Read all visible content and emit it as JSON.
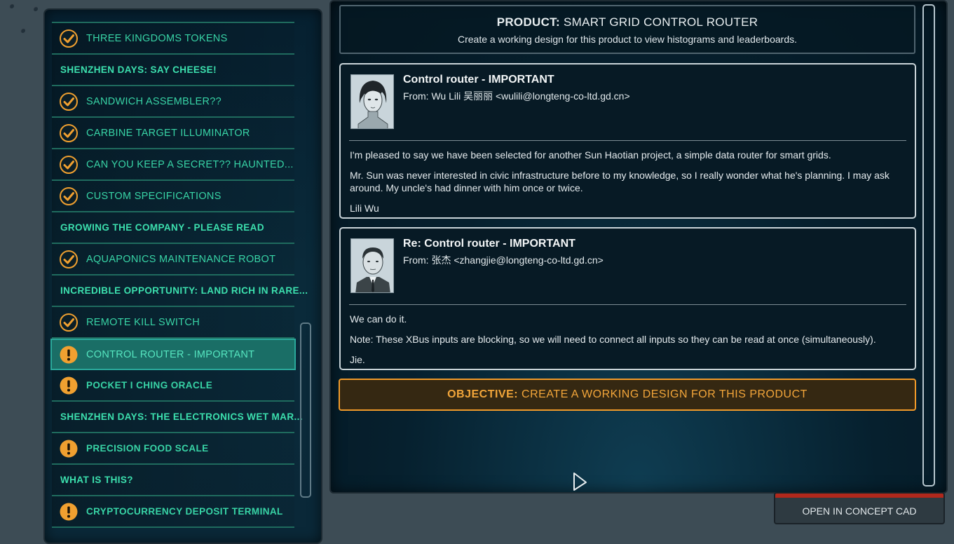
{
  "left_list": {
    "items": [
      {
        "label": "THREE KINGDOMS TOKENS",
        "type": "done"
      },
      {
        "label": "SHENZHEN DAYS: SAY CHEESE!",
        "type": "heading"
      },
      {
        "label": "SANDWICH ASSEMBLER??",
        "type": "done"
      },
      {
        "label": "CARBINE TARGET ILLUMINATOR",
        "type": "done"
      },
      {
        "label": "CAN YOU KEEP A SECRET?? HAUNTED...",
        "type": "done"
      },
      {
        "label": "CUSTOM SPECIFICATIONS",
        "type": "done"
      },
      {
        "label": "GROWING THE COMPANY - PLEASE READ",
        "type": "heading"
      },
      {
        "label": "AQUAPONICS MAINTENANCE ROBOT",
        "type": "done"
      },
      {
        "label": "INCREDIBLE OPPORTUNITY: LAND RICH IN RARE...",
        "type": "heading"
      },
      {
        "label": "REMOTE KILL SWITCH",
        "type": "done"
      },
      {
        "label": "CONTROL ROUTER - IMPORTANT",
        "type": "selected"
      },
      {
        "label": "POCKET I CHING ORACLE",
        "type": "urgent"
      },
      {
        "label": "SHENZHEN DAYS: THE ELECTRONICS WET MAR...",
        "type": "heading"
      },
      {
        "label": "PRECISION FOOD SCALE",
        "type": "urgent"
      },
      {
        "label": "WHAT IS THIS?",
        "type": "heading"
      },
      {
        "label": "CRYPTOCURRENCY DEPOSIT TERMINAL",
        "type": "urgent"
      }
    ]
  },
  "product": {
    "prefix": "PRODUCT:",
    "name": "SMART GRID CONTROL ROUTER",
    "subtitle": "Create a working design for this product to view histograms and leaderboards."
  },
  "emails": [
    {
      "subject": "Control router - IMPORTANT",
      "from": "From: Wu Lili 吴丽丽 <wulili@longteng-co-ltd.gd.cn>",
      "paragraphs": [
        "I'm pleased to say we have been selected for another Sun Haotian project, a simple data router for smart grids.",
        "Mr. Sun was never interested in civic infrastructure before to my knowledge, so I really wonder what he's planning. I may ask around. My uncle's had dinner with him once or twice.",
        "Lili Wu"
      ]
    },
    {
      "subject": "Re: Control router - IMPORTANT",
      "from": "From: 张杰 <zhangjie@longteng-co-ltd.gd.cn>",
      "paragraphs": [
        "We can do it.",
        "Note: These XBus inputs are blocking, so we will need to connect all inputs so they can be read at once (simultaneously).",
        "Jie."
      ]
    }
  ],
  "objective": {
    "prefix": "OBJECTIVE:",
    "text": "CREATE A WORKING DESIGN FOR THIS PRODUCT"
  },
  "buttons": {
    "open_cad": "OPEN IN CONCEPT CAD"
  },
  "colors": {
    "accent_teal": "#38d4a6",
    "objective_orange": "#f09a2a",
    "check_orange": "#f0a030",
    "cad_red": "#b0281c"
  }
}
